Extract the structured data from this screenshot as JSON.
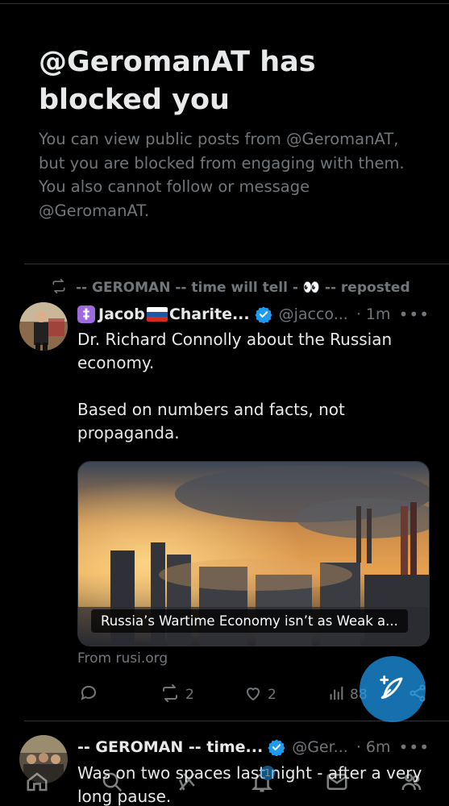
{
  "block_notice": {
    "title": "@GeromanAT has blocked you",
    "description": "You can view public posts from @GeromanAT, but you are blocked from engaging with them. You also cannot follow or message @GeromanAT."
  },
  "posts": [
    {
      "repost_label": "-- GEROMAN -- time will tell - 👀 -- reposted",
      "name_badge": "‡",
      "name_part1": "Jacob",
      "name_part2": "Charite...",
      "handle": "@jacco...",
      "time": "· 1m",
      "more": "•••",
      "text": "Dr. Richard Connolly about the Russian economy.\n\nBased on numbers and facts, not propaganda.",
      "card_caption": "Russia’s Wartime Economy isn’t as Weak a...",
      "card_source": "From rusi.org",
      "actions": {
        "reply_count": "",
        "repost_count": "2",
        "like_count": "2",
        "views_count": "88"
      }
    },
    {
      "name": "-- GEROMAN -- time...",
      "handle": "@Ger...",
      "time": "· 6m",
      "more": "•••",
      "text": "Was on two spaces last night - after a very long pause."
    }
  ],
  "bottom_nav": {
    "notifications_badge": "1"
  },
  "colors": {
    "background": "#000000",
    "text_primary": "#e7e9ea",
    "text_secondary": "#71767b",
    "accent": "#1d9bf0",
    "divider": "#2f3336"
  },
  "icons": [
    "repost-icon",
    "verified-icon",
    "reply-icon",
    "like-icon",
    "views-icon",
    "share-icon",
    "compose-icon",
    "home-icon",
    "search-icon",
    "grok-icon",
    "notifications-icon",
    "messages-icon",
    "communities-icon"
  ]
}
